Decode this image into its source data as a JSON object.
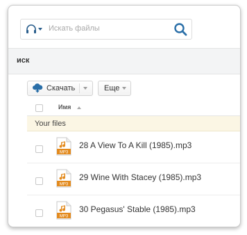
{
  "search": {
    "placeholder": "Искать файлы",
    "source_icon": "headset-icon"
  },
  "header_band": {
    "text": "иск"
  },
  "toolbar": {
    "download_label": "Скачать",
    "more_label": "Еще"
  },
  "table": {
    "name_column": "Имя",
    "section_label": "Your files",
    "files": [
      {
        "name": "28 A View To A Kill (1985).mp3",
        "type_badge": "MP3"
      },
      {
        "name": "29 Wine With Stacey (1985).mp3",
        "type_badge": "MP3"
      },
      {
        "name": "30 Pegasus' Stable (1985).mp3",
        "type_badge": "MP3"
      }
    ]
  },
  "colors": {
    "accent_blue": "#2a6fa8",
    "mp3_orange": "#e38a1d",
    "section_bg": "#fbf6e4"
  }
}
